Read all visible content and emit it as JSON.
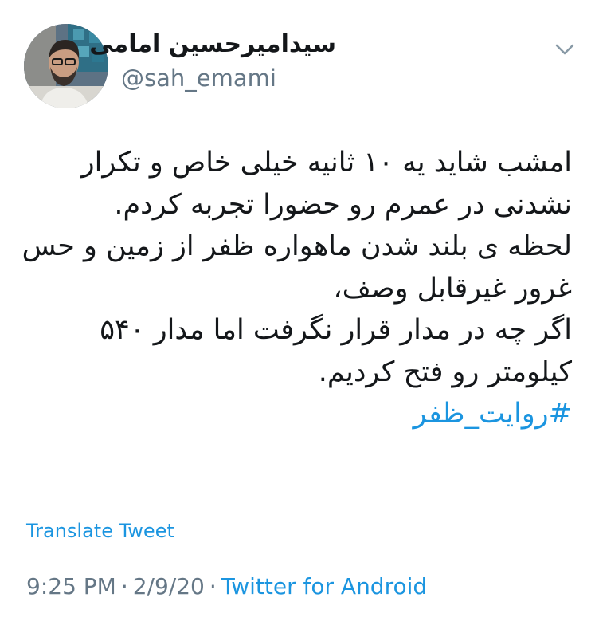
{
  "author": {
    "display_name": "سیدامیرحسین امامی",
    "handle": "@sah_emami"
  },
  "tweet": {
    "lines": [
      "امشب شاید یه ۱۰ ثانیه خیلی خاص و تکرار",
      "نشدنی در عمرم رو حضورا تجربه کردم.",
      "لحظه ی بلند شدن ماهواره ظفر از زمین و حس",
      "غرور غیرقابل وصف،",
      "اگر چه در مدار قرار نگرفت اما مدار ۵۴۰",
      "کیلومتر رو فتح کردیم."
    ],
    "hashtag": "#روایت_ظفر"
  },
  "translate_label": "Translate Tweet",
  "meta": {
    "time": "9:25 PM",
    "date": "2/9/20",
    "separator": "·",
    "source": "Twitter for Android"
  },
  "icons": {
    "menu": "chevron-down-icon",
    "avatar": "profile-photo"
  },
  "colors": {
    "link": "#1b95e0",
    "secondary_text": "#657786",
    "primary_text": "#14171a"
  }
}
